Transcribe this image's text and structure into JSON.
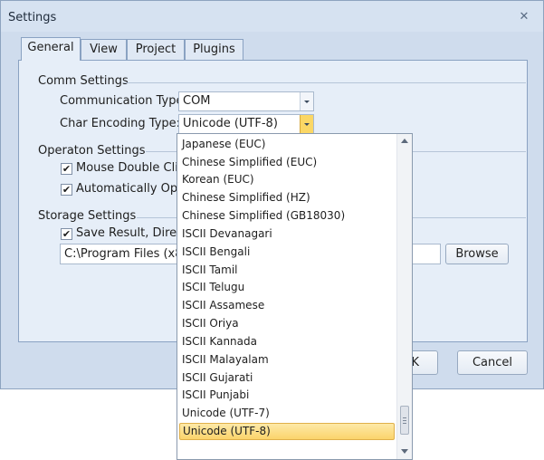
{
  "window": {
    "title": "Settings",
    "close_glyph": "✕"
  },
  "tabs": [
    {
      "label": "General",
      "active": true
    },
    {
      "label": "View"
    },
    {
      "label": "Project"
    },
    {
      "label": "Plugins"
    }
  ],
  "comm_settings": {
    "group_label": "Comm Settings",
    "communication_type_label": "Communication Type:",
    "communication_type_value": "COM",
    "char_encoding_label": "Char Encoding Type:",
    "char_encoding_value": "Unicode (UTF-8)"
  },
  "operation_settings": {
    "group_label": "Operaton Settings",
    "mouse_double_click_label": "Mouse Double Click",
    "mouse_double_click_checked": true,
    "automatically_open_label": "Automatically Open",
    "automatically_open_checked": true
  },
  "storage_settings": {
    "group_label": "Storage Settings",
    "save_result_label": "Save Result, Directo",
    "save_result_checked": true,
    "path_value": "C:\\Program Files (x86)",
    "browse_label": "Browse"
  },
  "footer": {
    "ok_label": "K",
    "cancel_label": "Cancel"
  },
  "encoding_dropdown": {
    "options": [
      "Japanese (EUC)",
      "Chinese Simplified (EUC)",
      "Korean (EUC)",
      "Chinese Simplified (HZ)",
      "Chinese Simplified (GB18030)",
      "ISCII Devanagari",
      "ISCII Bengali",
      "ISCII Tamil",
      "ISCII Telugu",
      "ISCII Assamese",
      "ISCII Oriya",
      "ISCII Kannada",
      "ISCII Malayalam",
      "ISCII Gujarati",
      "ISCII Punjabi",
      "Unicode (UTF-7)",
      "Unicode (UTF-8)"
    ],
    "selected": "Unicode (UTF-8)"
  },
  "colors": {
    "window_bg": "#cfdced",
    "panel_bg": "#e6eef8",
    "selection_highlight": "#fbd46b"
  }
}
